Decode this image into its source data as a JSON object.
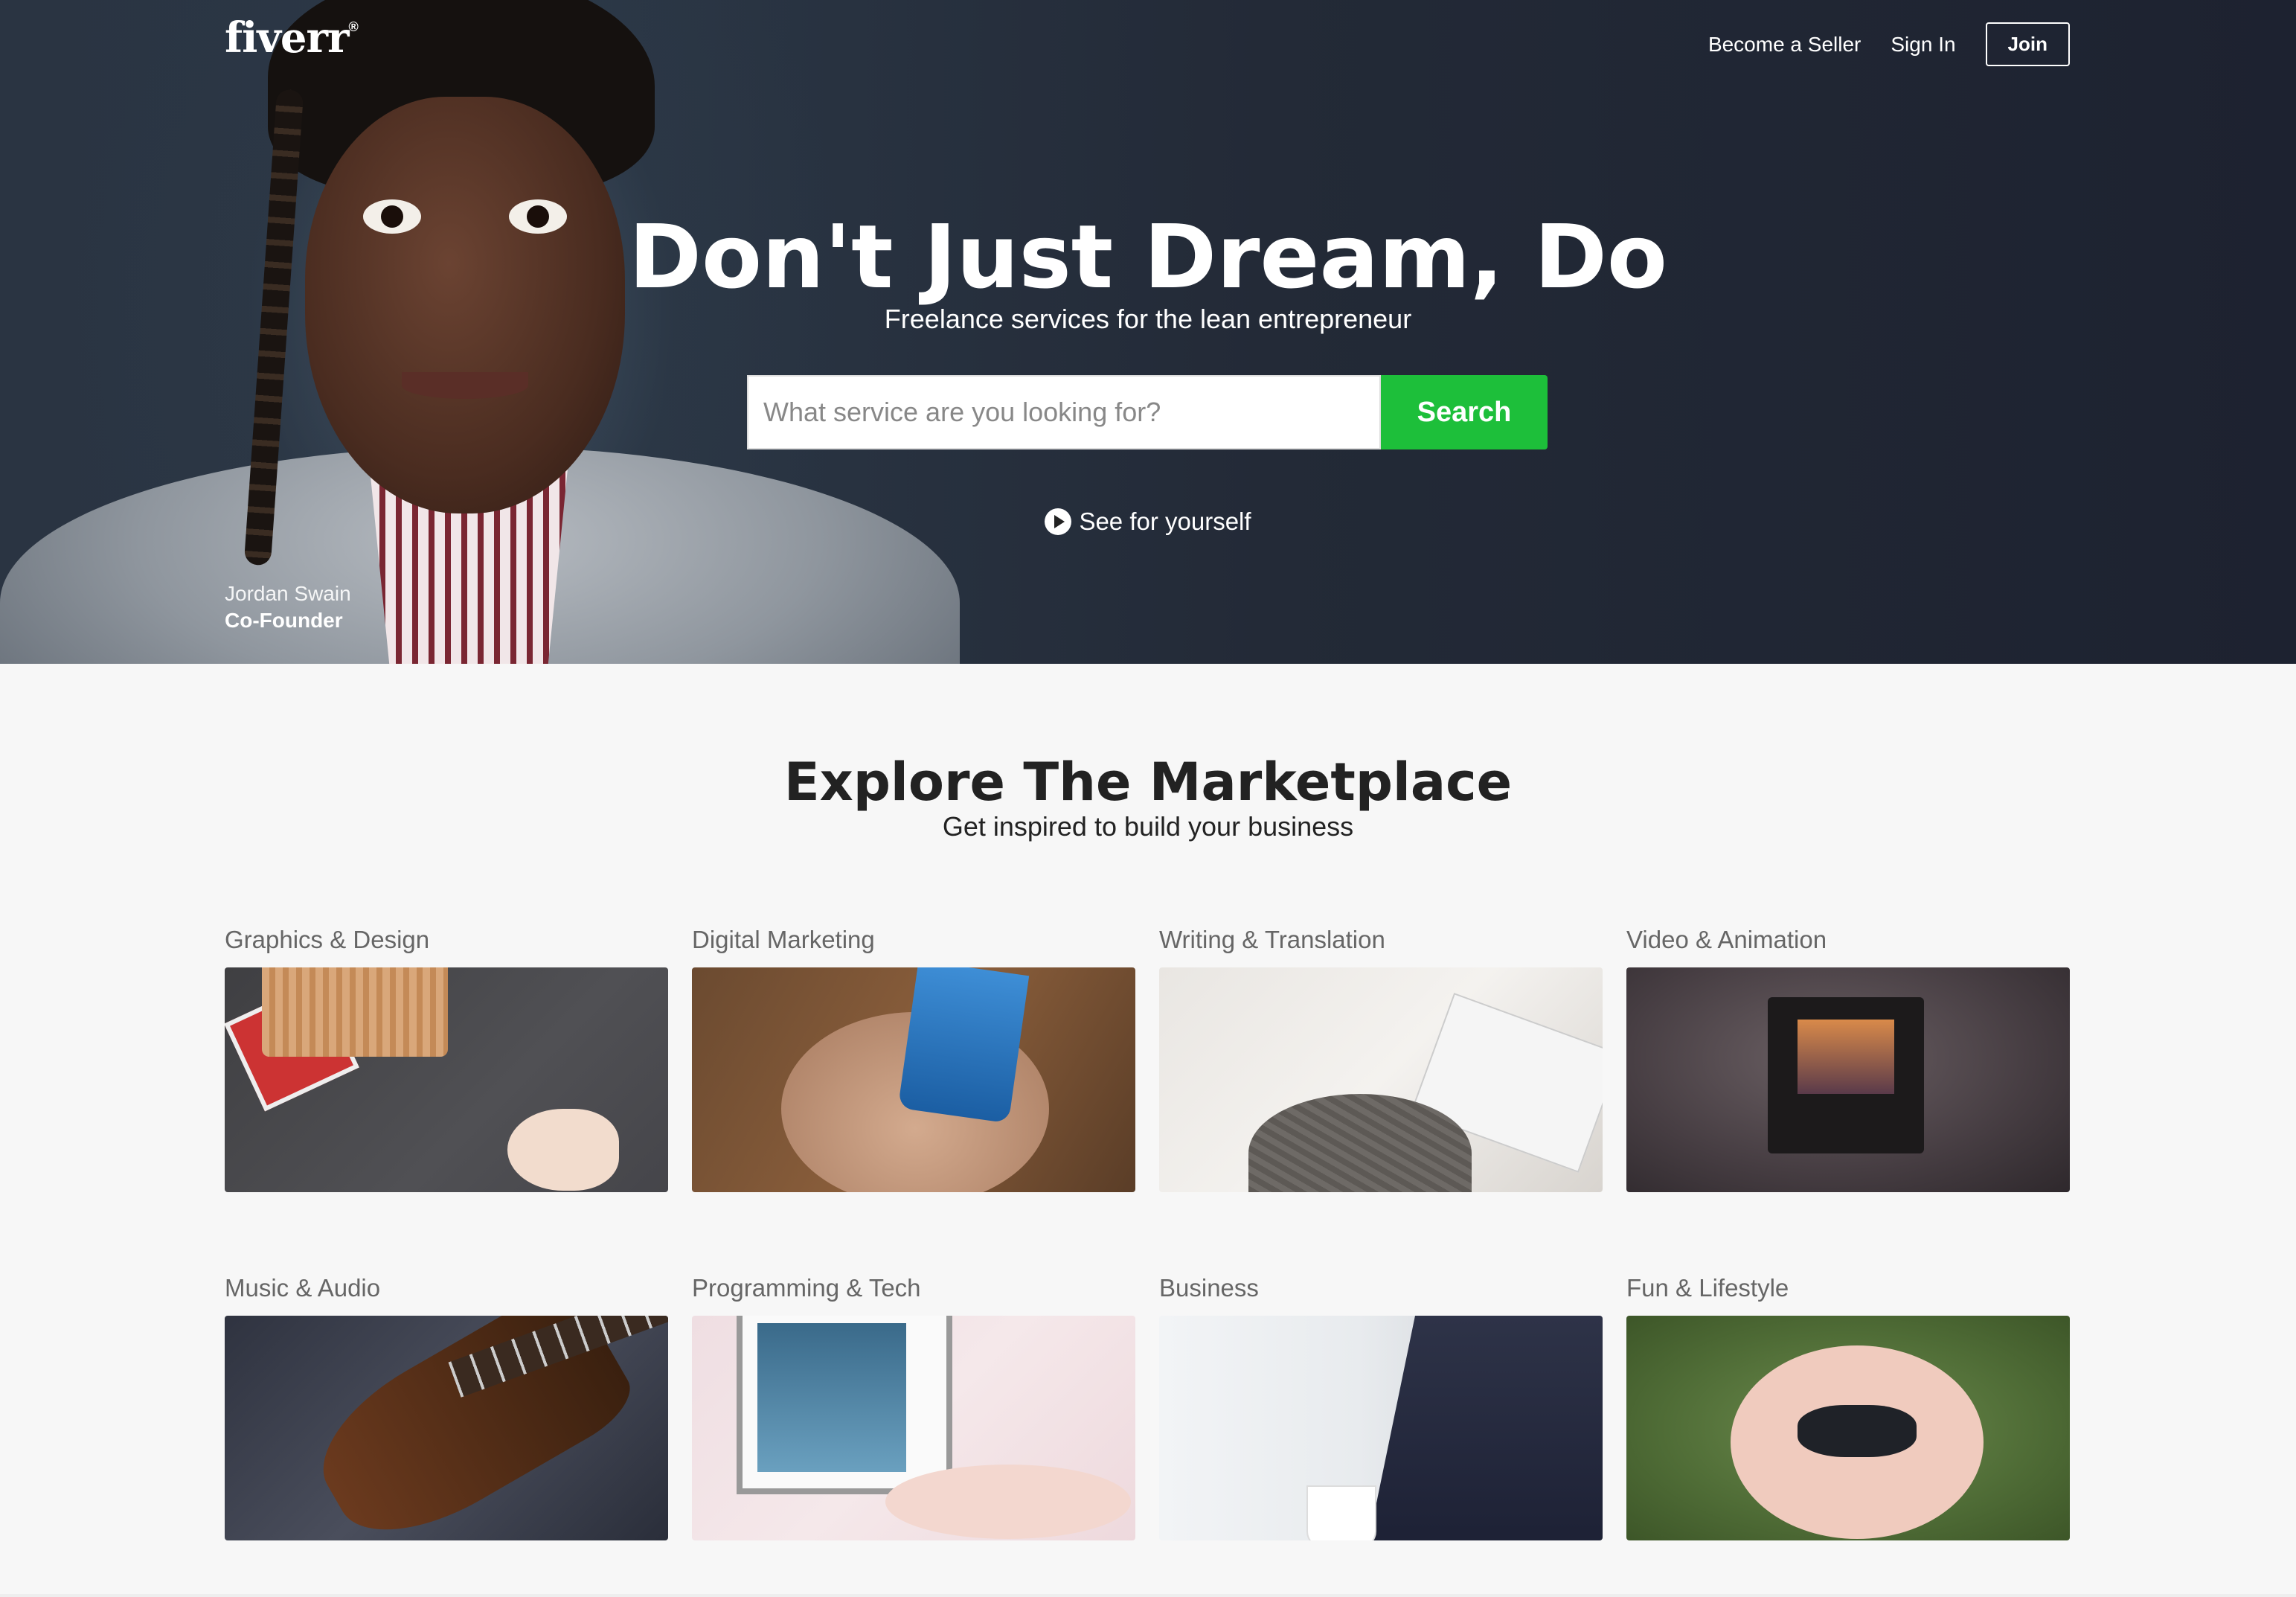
{
  "header": {
    "logo": "fiverr",
    "logo_mark": "®",
    "nav": {
      "become_seller": "Become a Seller",
      "sign_in": "Sign In",
      "join": "Join"
    }
  },
  "hero": {
    "title": "Don't Just Dream, Do",
    "subtitle": "Freelance services for the lean entrepreneur",
    "search": {
      "placeholder": "What service are you looking for?",
      "value": "",
      "button": "Search"
    },
    "video_link": "See for yourself",
    "video_icon": "play-icon",
    "caption": {
      "name": "Jordan Swain",
      "role": "Co-Founder"
    }
  },
  "marketplace": {
    "title": "Explore The Marketplace",
    "subtitle": "Get inspired to build your business",
    "categories": [
      {
        "label": "Graphics & Design"
      },
      {
        "label": "Digital Marketing"
      },
      {
        "label": "Writing & Translation"
      },
      {
        "label": "Video & Animation"
      },
      {
        "label": "Music & Audio"
      },
      {
        "label": "Programming & Tech"
      },
      {
        "label": "Business"
      },
      {
        "label": "Fun & Lifestyle"
      }
    ]
  },
  "colors": {
    "search_button": "#1dbf3a",
    "hero_bg": "#1d2230",
    "page_bg": "#f7f7f7"
  }
}
